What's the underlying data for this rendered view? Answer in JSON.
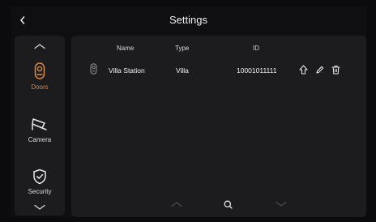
{
  "header": {
    "title": "Settings"
  },
  "colors": {
    "accent": "#d58a4c",
    "panel": "#1c1c1f",
    "background": "#0f0f11"
  },
  "sidebar": {
    "items": [
      {
        "label": "Doors",
        "icon": "doorbell-icon",
        "active": true
      },
      {
        "label": "Camera",
        "icon": "camera-icon",
        "active": false
      },
      {
        "label": "Security",
        "icon": "shield-check-icon",
        "active": false
      }
    ]
  },
  "table": {
    "columns": [
      "Name",
      "Type",
      "ID"
    ],
    "rows": [
      {
        "name": "Villa Station",
        "type": "Villa",
        "id": "10001011111"
      }
    ]
  }
}
